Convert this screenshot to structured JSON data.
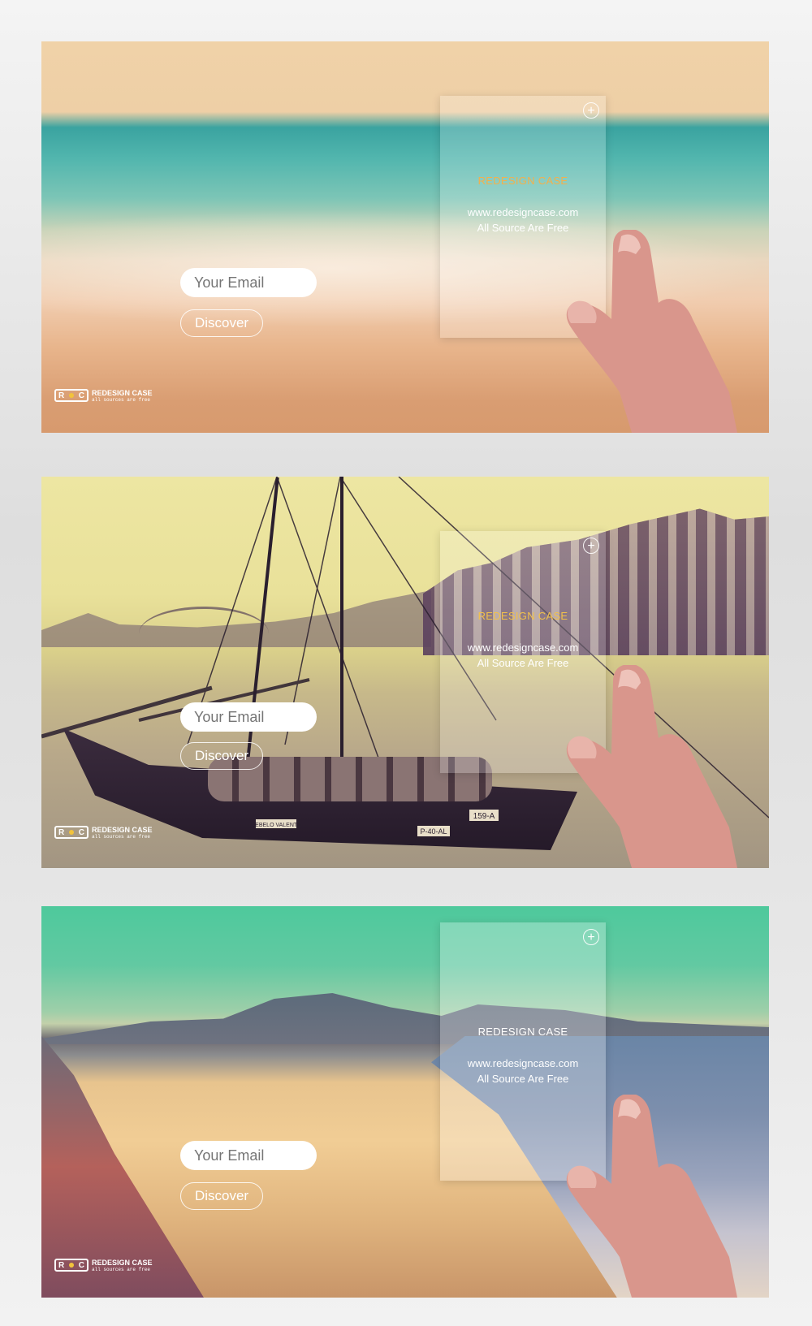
{
  "panels": [
    {
      "email_placeholder": "Your Email",
      "discover_label": "Discover",
      "card": {
        "title": "REDESIGN CASE",
        "url": "www.redesigncase.com",
        "note": "All Source Are Free"
      },
      "logo": {
        "mark": "RC",
        "name": "REDESIGN CASE",
        "tagline": "all sources are free"
      }
    },
    {
      "email_placeholder": "Your Email",
      "discover_label": "Discover",
      "card": {
        "title": "REDESIGN CASE",
        "url": "www.redesigncase.com",
        "note": "All Source Are Free"
      },
      "boat_labels": {
        "name": "REBELO VALENTE",
        "reg1": "159-A",
        "reg2": "P-40-AL"
      },
      "logo": {
        "mark": "RC",
        "name": "REDESIGN CASE",
        "tagline": "all sources are free"
      }
    },
    {
      "email_placeholder": "Your Email",
      "discover_label": "Discover",
      "card": {
        "title": "REDESIGN CASE",
        "url": "www.redesigncase.com",
        "note": "All Source Are Free"
      },
      "logo": {
        "mark": "RC",
        "name": "REDESIGN CASE",
        "tagline": "all sources are free"
      }
    }
  ],
  "icons": {
    "card_add": "plus-circle-icon"
  },
  "colors": {
    "email_text_1": "#3f8c81",
    "email_text_3": "#d0705d",
    "card_title_accent": "#f3b04c",
    "logo_dot": "#f2c33b"
  }
}
